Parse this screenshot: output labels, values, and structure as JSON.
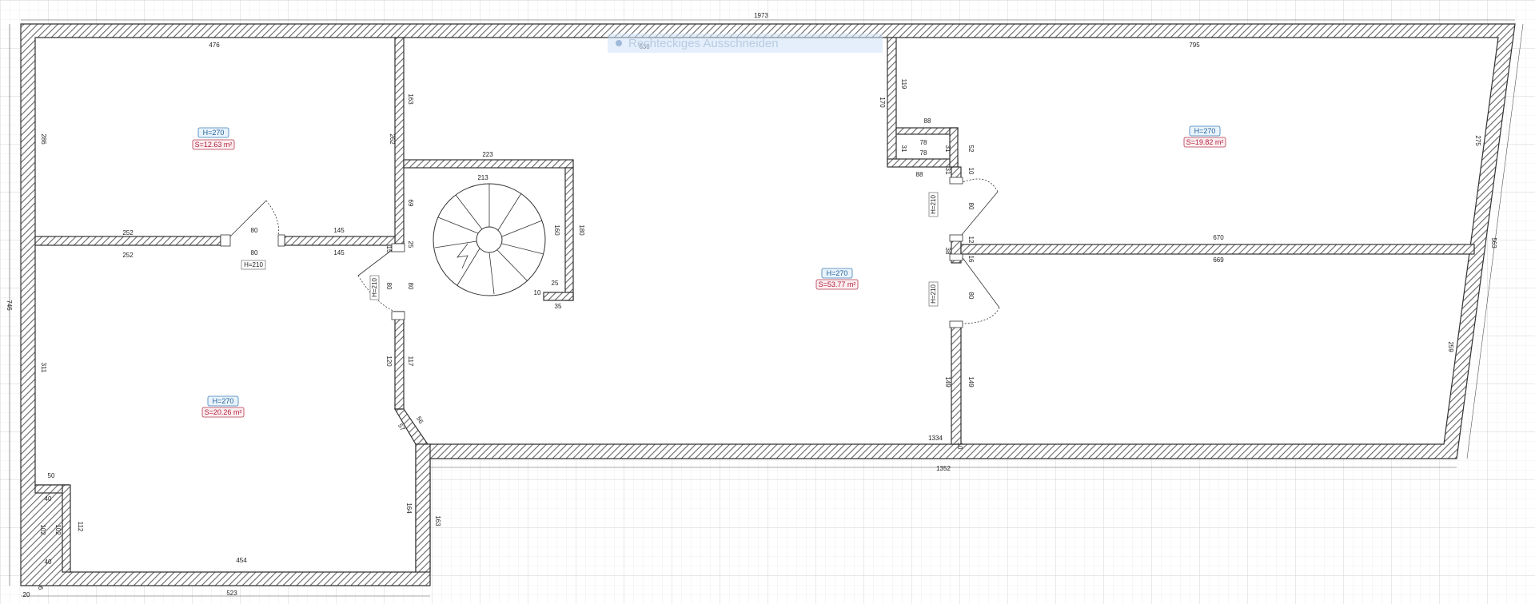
{
  "overlay": {
    "tooltip": "Rechteckiges Ausschneiden"
  },
  "dimensions": {
    "total_width": "1973",
    "left_top_room_width": "476",
    "middle_top_width": "638",
    "right_top_width": "795",
    "left_top_height": "286",
    "mid_left_upper": "163",
    "mid_left_wall": "262",
    "stair_wall_top": "223",
    "stair_dia": "213",
    "stair_h1": "160",
    "stair_h2": "180",
    "stair_25": "25",
    "stair_10": "10",
    "stair_35": "35",
    "closet_top": "88",
    "closet_left": "170",
    "closet_119": "119",
    "closet_31a": "31",
    "closet_78a": "78",
    "closet_78b": "78",
    "closet_31b": "31",
    "closet_52": "52",
    "closet_bottom": "88",
    "r_31": "31",
    "r_10": "10",
    "r_80a": "80",
    "r_12": "12",
    "r_670": "670",
    "r_38": "38",
    "r_16": "16",
    "r_669": "669",
    "r_80b": "80",
    "right_275": "275",
    "right_563": "563",
    "right_259": "259",
    "r_149a": "149",
    "r_149b": "149",
    "inner_1334": "1334",
    "inner_10": "10",
    "outer_1352": "1352",
    "left_252a": "252",
    "left_80a": "80",
    "left_145a": "145",
    "left_252b": "252",
    "left_80b": "80",
    "left_145b": "145",
    "d_15": "15",
    "d_25": "25",
    "d_69": "69",
    "d_80a": "80",
    "d_80b": "80",
    "d_120": "120",
    "d_117": "117",
    "d_57": "57",
    "d_56": "56",
    "total_height": "746",
    "left_311": "311",
    "left_50": "50",
    "left_40a": "40",
    "left_102a": "102",
    "left_102b": "102",
    "left_112": "112",
    "left_40b": "40",
    "bottom_454": "454",
    "bottom_523": "523",
    "bottom_20": "20",
    "bottom_6": "6",
    "bottom_164": "164",
    "bottom_163": "163"
  },
  "rooms": [
    {
      "height": "H=270",
      "area": "S=12.63 m²"
    },
    {
      "height": "H=270",
      "area": "S=53.77 m²"
    },
    {
      "height": "H=270",
      "area": "S=19.82 m²"
    },
    {
      "height": "H=270",
      "area": "S=20.26 m²"
    }
  ],
  "doors": [
    "H=210",
    "H=210",
    "H=210",
    "H=210"
  ]
}
